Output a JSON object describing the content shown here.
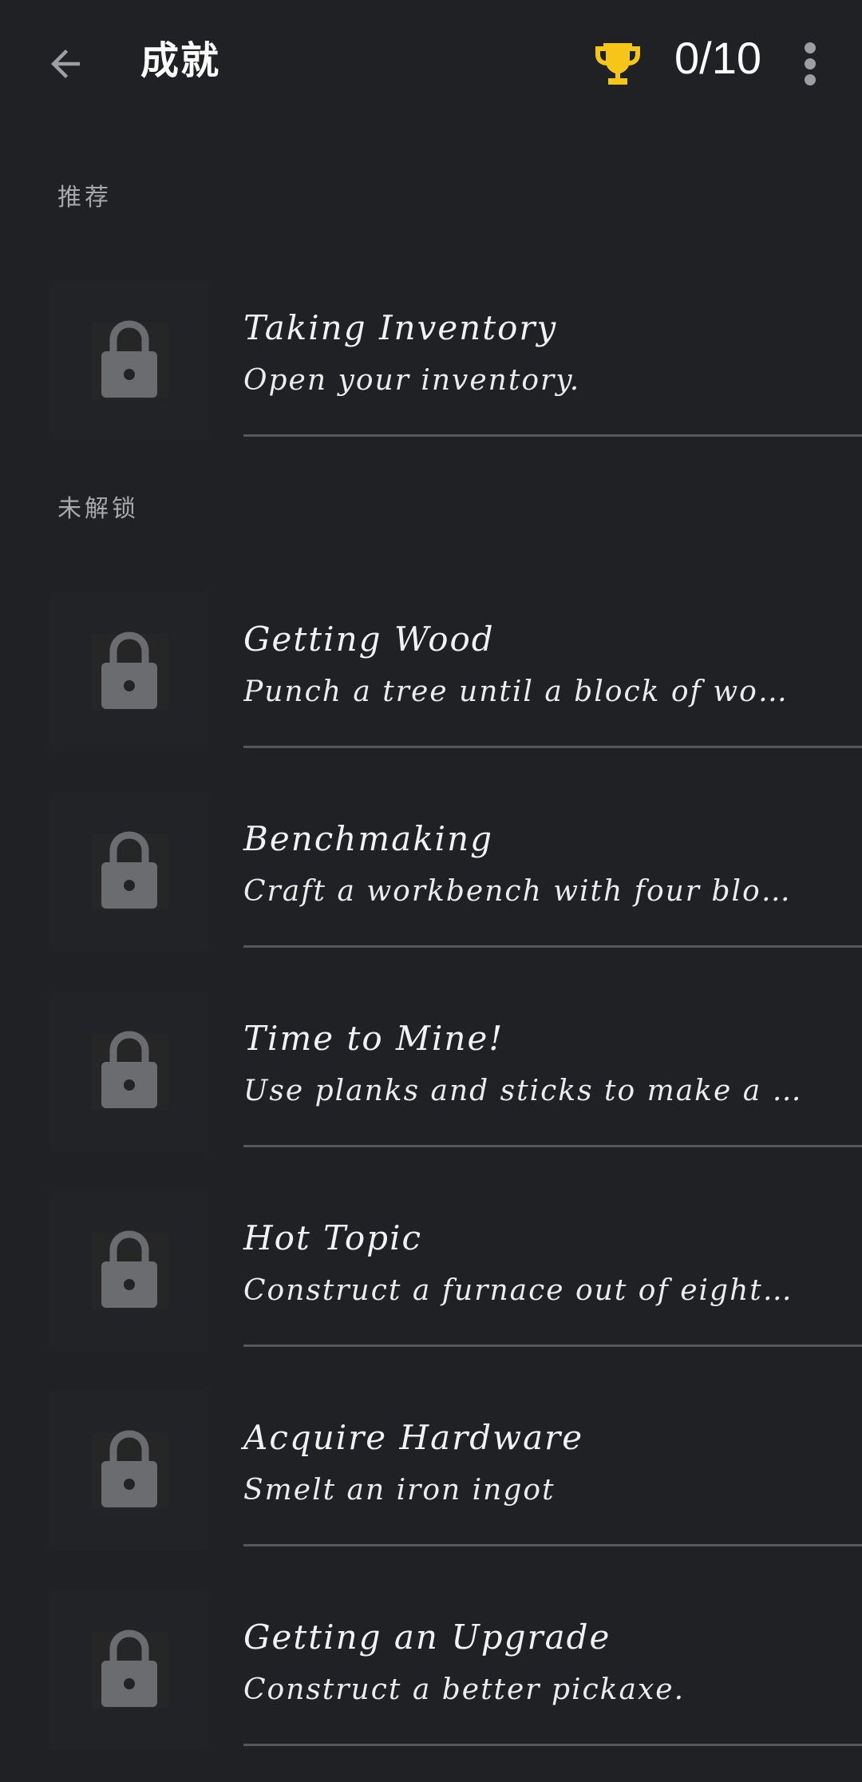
{
  "header": {
    "title": "成就",
    "count": "0/10",
    "back_icon": "arrow-left-icon",
    "trophy_icon": "trophy-icon",
    "more_icon": "more-vert-icon",
    "trophy_color": "#f5c518"
  },
  "sections": {
    "recommended": "推荐",
    "locked": "未解锁"
  },
  "recommended_items": [
    {
      "name": "Taking Inventory",
      "description": "Open your inventory."
    }
  ],
  "locked_items": [
    {
      "name": "Getting Wood",
      "description": "Punch a tree until a block of wood p…"
    },
    {
      "name": "Benchmaking",
      "description": "Craft a workbench with four blocks …"
    },
    {
      "name": "Time to Mine!",
      "description": "Use planks and sticks to make a pic…"
    },
    {
      "name": "Hot Topic",
      "description": "Construct a furnace out of eight cob…"
    },
    {
      "name": "Acquire Hardware",
      "description": "Smelt an iron ingot"
    },
    {
      "name": "Getting an Upgrade",
      "description": "Construct a better pickaxe."
    }
  ],
  "colors": {
    "background": "#202124",
    "lock": "#6a6c70",
    "divider": "#55575b"
  }
}
